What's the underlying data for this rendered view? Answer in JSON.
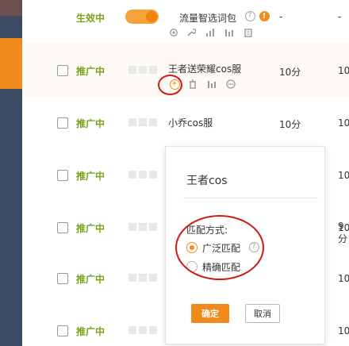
{
  "rows": [
    {
      "status": "生效中",
      "keyword": "流量智选词包",
      "price": "-",
      "trunc": "-"
    },
    {
      "status": "推广中",
      "keyword": "王者送荣耀cos服",
      "price": "10分",
      "trunc": "10"
    },
    {
      "status": "推广中",
      "keyword": "小乔cos服",
      "price": "10分",
      "trunc": "10"
    },
    {
      "status": "推广中",
      "keyword": "",
      "price": "",
      "trunc": "10"
    },
    {
      "status": "推广中",
      "keyword": "",
      "price": "",
      "trunc": "10"
    },
    {
      "status": "推广中",
      "keyword": "",
      "price": "",
      "trunc": "9分"
    },
    {
      "status": "推广中",
      "keyword": "",
      "price": "",
      "trunc": "10"
    },
    {
      "status": "推广中",
      "keyword": "",
      "price": "",
      "trunc": "10"
    }
  ],
  "icons": {
    "row0": [
      "settings-icon",
      "wrench-icon",
      "bar-chart-icon",
      "column-chart-icon",
      "clipboard-icon"
    ],
    "row1": [
      "add-icon",
      "delete-icon",
      "column-chart-icon",
      "more-icon"
    ],
    "help_glyph": "?",
    "warn_glyph": "!",
    "add_glyph": "+"
  },
  "popover": {
    "title": "王者cos",
    "match_label": "匹配方式:",
    "options": [
      {
        "label": "广泛匹配",
        "checked": true
      },
      {
        "label": "精确匹配",
        "checked": false
      }
    ],
    "help_glyph": "?",
    "confirm": "确定",
    "cancel": "取消"
  },
  "colors": {
    "accent": "#f08a1c",
    "status_green": "#7ba21b",
    "annotation_red": "#d0181a",
    "sidebar": "#3c4a63"
  }
}
